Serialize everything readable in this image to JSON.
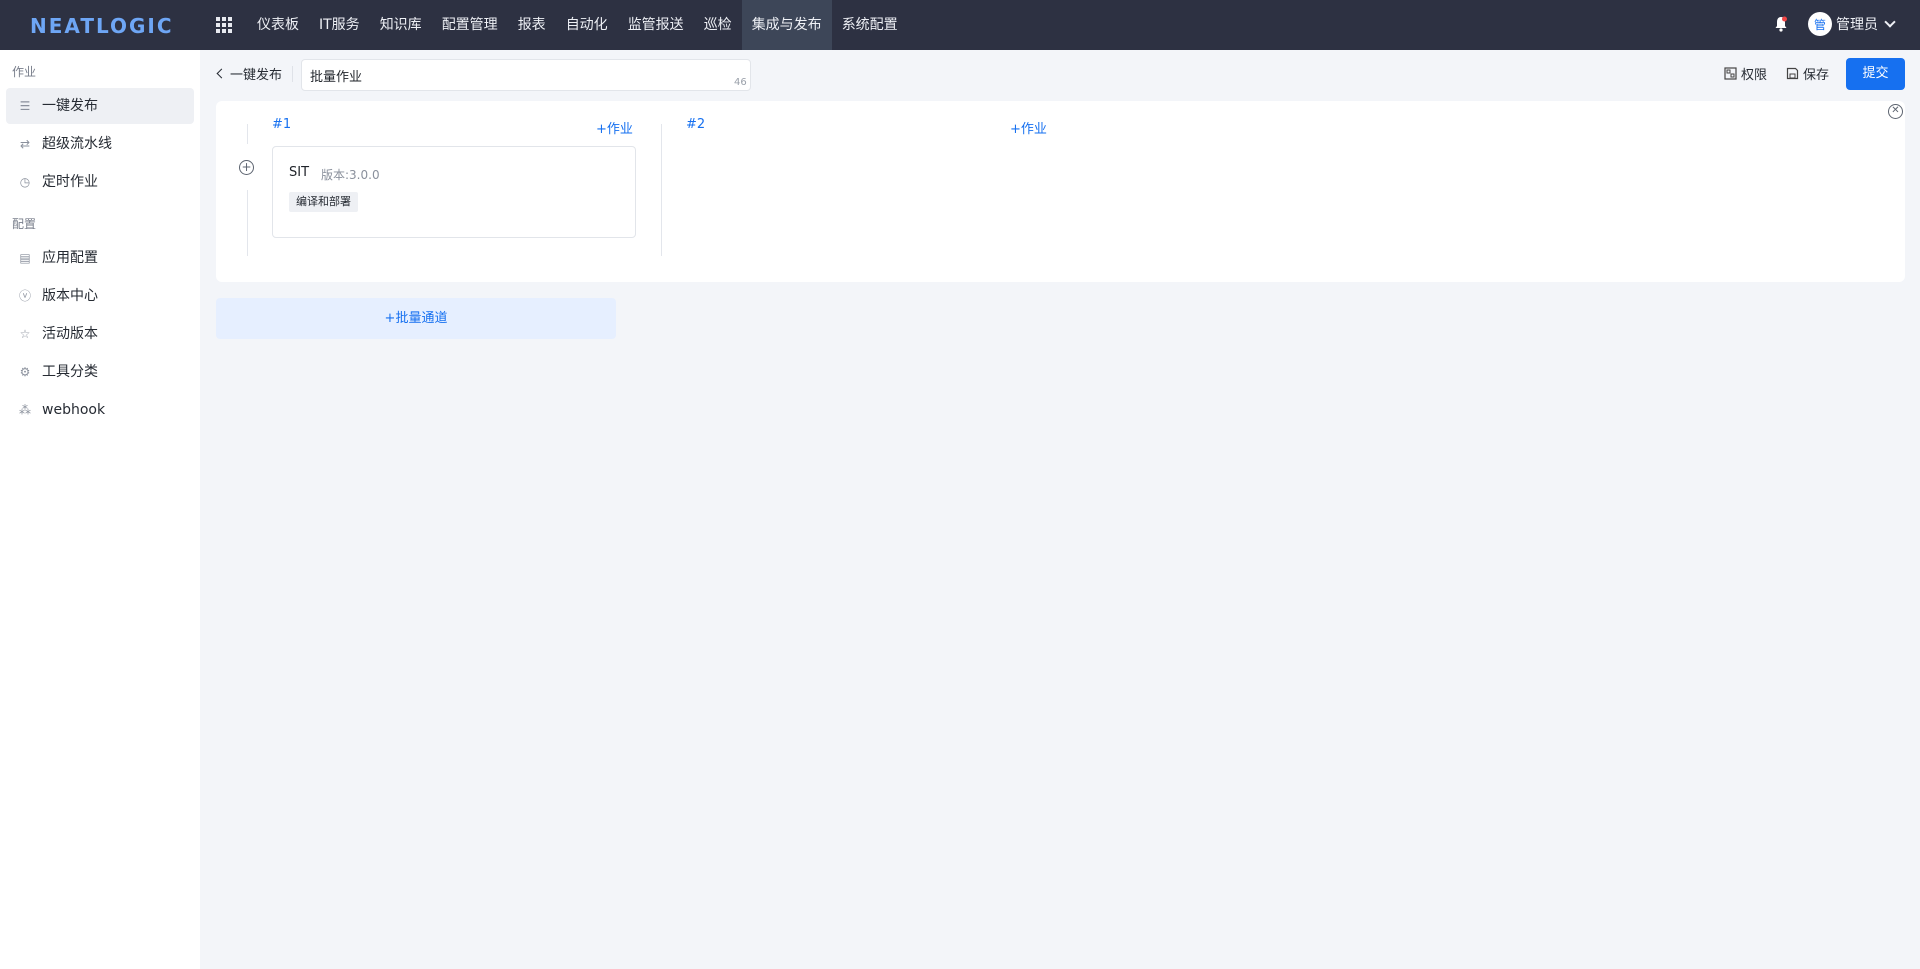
{
  "app": {
    "logo": "NEATLOGIC"
  },
  "nav": {
    "items": [
      "仪表板",
      "IT服务",
      "知识库",
      "配置管理",
      "报表",
      "自动化",
      "监管报送",
      "巡检",
      "集成与发布",
      "系统配置"
    ],
    "active_index": 8
  },
  "user": {
    "avatar_text": "管",
    "name": "管理员"
  },
  "sidebar": {
    "groups": [
      {
        "label": "作业",
        "items": [
          "一键发布",
          "超级流水线",
          "定时作业"
        ]
      },
      {
        "label": "配置",
        "items": [
          "应用配置",
          "版本中心",
          "活动版本",
          "工具分类",
          "webhook"
        ]
      }
    ],
    "active_item": "一键发布"
  },
  "header": {
    "back_label": "一键发布",
    "title_value": "批量作业",
    "title_count": "46",
    "permission_label": "权限",
    "save_label": "保存",
    "submit_label": "提交"
  },
  "lanes": [
    {
      "title": "#1",
      "add_label": "作业",
      "jobs": [
        {
          "name": "SIT",
          "version": "版本:3.0.0",
          "tag": "编译和部署"
        }
      ]
    },
    {
      "title": "#2",
      "add_label": "作业",
      "jobs": []
    }
  ],
  "batch_channel_label": "批量通道",
  "colors": {
    "topbar": "#2d3142",
    "accent": "#1670f0",
    "logo": "#6ea6f5"
  }
}
